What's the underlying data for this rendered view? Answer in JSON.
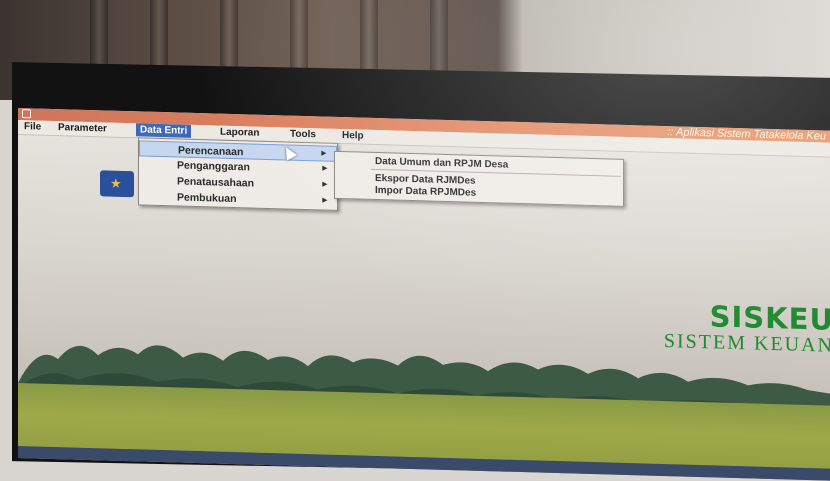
{
  "window": {
    "title": ":: Aplikasi Sistem Tatakelola Keu"
  },
  "menubar": {
    "items": [
      {
        "label": "File"
      },
      {
        "label": "Parameter"
      },
      {
        "label": "Data Entri"
      },
      {
        "label": "Laporan"
      },
      {
        "label": "Tools"
      },
      {
        "label": "Help"
      }
    ],
    "active": "Data Entri"
  },
  "dropdown": {
    "items": [
      {
        "label": "Perencanaan",
        "has_submenu": true
      },
      {
        "label": "Penganggaran",
        "has_submenu": true
      },
      {
        "label": "Penatausahaan",
        "has_submenu": true
      },
      {
        "label": "Pembukuan",
        "has_submenu": true
      }
    ],
    "highlighted": "Perencanaan"
  },
  "submenu": {
    "items": [
      {
        "label": "Data Umum dan RPJM Desa"
      },
      {
        "label": "Ekspor Data RJMDes"
      },
      {
        "label": "Impor Data RPJMDes"
      }
    ]
  },
  "brand": {
    "name": "SISKEU",
    "subtitle": "SISTEM KEUAN"
  },
  "colors": {
    "titlebar": "#e38a64",
    "menu_active": "#3d69b8",
    "brand_green": "#1f8a2f"
  },
  "icons": {
    "arrow": "▸",
    "logo": "★"
  }
}
